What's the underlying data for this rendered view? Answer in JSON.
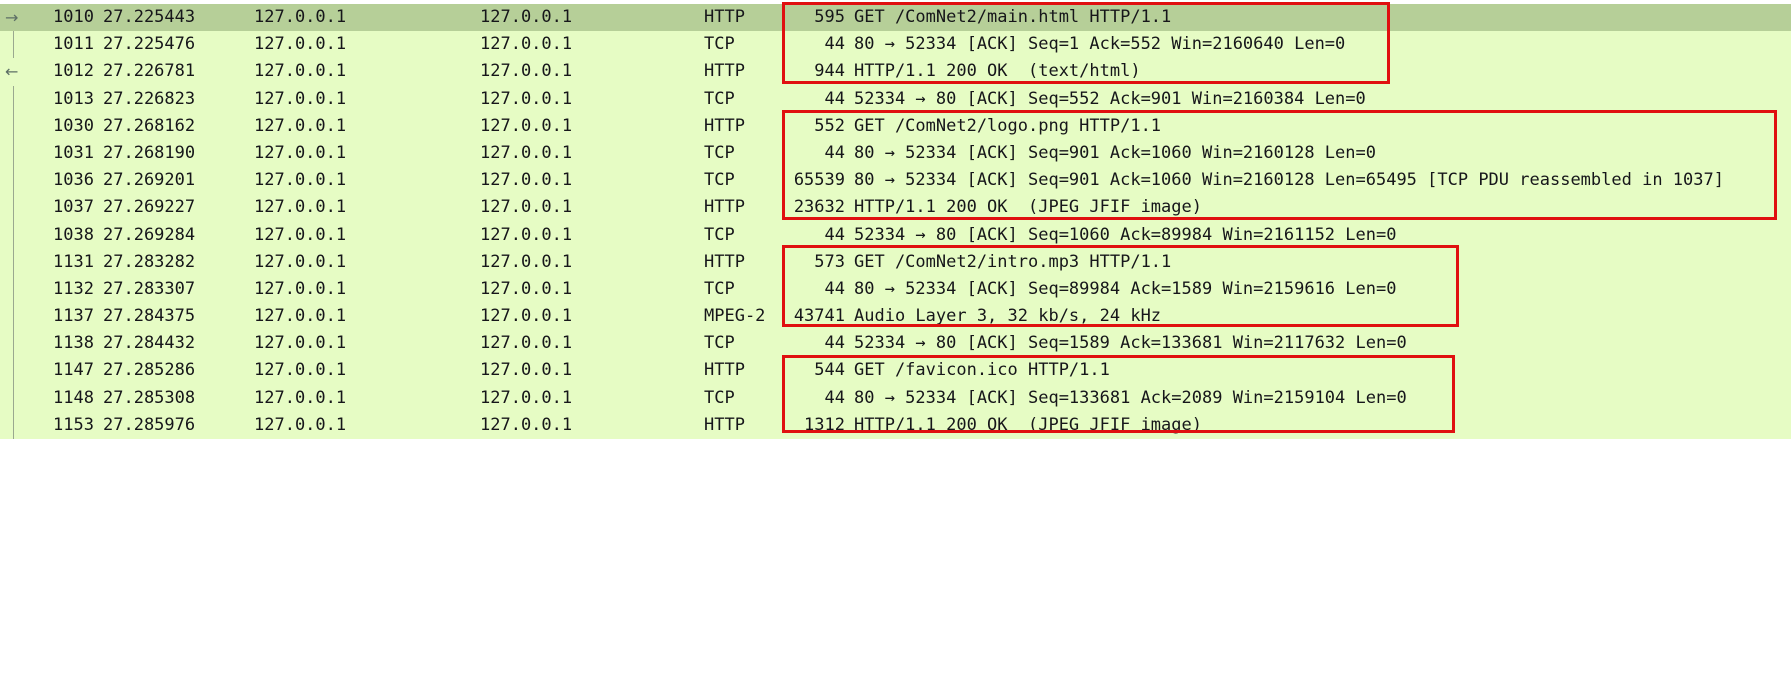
{
  "packets": [
    {
      "no": "1010",
      "time": "27.225443",
      "src": "127.0.0.1",
      "dst": "127.0.0.1",
      "proto": "HTTP",
      "len": "595",
      "info": "GET /ComNet2/main.html HTTP/1.1"
    },
    {
      "no": "1011",
      "time": "27.225476",
      "src": "127.0.0.1",
      "dst": "127.0.0.1",
      "proto": "TCP",
      "len": "44",
      "info": "80 → 52334 [ACK] Seq=1 Ack=552 Win=2160640 Len=0"
    },
    {
      "no": "1012",
      "time": "27.226781",
      "src": "127.0.0.1",
      "dst": "127.0.0.1",
      "proto": "HTTP",
      "len": "944",
      "info": "HTTP/1.1 200 OK  (text/html)"
    },
    {
      "no": "1013",
      "time": "27.226823",
      "src": "127.0.0.1",
      "dst": "127.0.0.1",
      "proto": "TCP",
      "len": "44",
      "info": "52334 → 80 [ACK] Seq=552 Ack=901 Win=2160384 Len=0"
    },
    {
      "no": "1030",
      "time": "27.268162",
      "src": "127.0.0.1",
      "dst": "127.0.0.1",
      "proto": "HTTP",
      "len": "552",
      "info": "GET /ComNet2/logo.png HTTP/1.1"
    },
    {
      "no": "1031",
      "time": "27.268190",
      "src": "127.0.0.1",
      "dst": "127.0.0.1",
      "proto": "TCP",
      "len": "44",
      "info": "80 → 52334 [ACK] Seq=901 Ack=1060 Win=2160128 Len=0"
    },
    {
      "no": "1036",
      "time": "27.269201",
      "src": "127.0.0.1",
      "dst": "127.0.0.1",
      "proto": "TCP",
      "len": "65539",
      "info": "80 → 52334 [ACK] Seq=901 Ack=1060 Win=2160128 Len=65495 [TCP PDU reassembled in 1037]"
    },
    {
      "no": "1037",
      "time": "27.269227",
      "src": "127.0.0.1",
      "dst": "127.0.0.1",
      "proto": "HTTP",
      "len": "23632",
      "info": "HTTP/1.1 200 OK  (JPEG JFIF image)"
    },
    {
      "no": "1038",
      "time": "27.269284",
      "src": "127.0.0.1",
      "dst": "127.0.0.1",
      "proto": "TCP",
      "len": "44",
      "info": "52334 → 80 [ACK] Seq=1060 Ack=89984 Win=2161152 Len=0"
    },
    {
      "no": "1131",
      "time": "27.283282",
      "src": "127.0.0.1",
      "dst": "127.0.0.1",
      "proto": "HTTP",
      "len": "573",
      "info": "GET /ComNet2/intro.mp3 HTTP/1.1"
    },
    {
      "no": "1132",
      "time": "27.283307",
      "src": "127.0.0.1",
      "dst": "127.0.0.1",
      "proto": "TCP",
      "len": "44",
      "info": "80 → 52334 [ACK] Seq=89984 Ack=1589 Win=2159616 Len=0"
    },
    {
      "no": "1137",
      "time": "27.284375",
      "src": "127.0.0.1",
      "dst": "127.0.0.1",
      "proto": "MPEG-2",
      "len": "43741",
      "info": "Audio Layer 3, 32 kb/s, 24 kHz"
    },
    {
      "no": "1138",
      "time": "27.284432",
      "src": "127.0.0.1",
      "dst": "127.0.0.1",
      "proto": "TCP",
      "len": "44",
      "info": "52334 → 80 [ACK] Seq=1589 Ack=133681 Win=2117632 Len=0"
    },
    {
      "no": "1147",
      "time": "27.285286",
      "src": "127.0.0.1",
      "dst": "127.0.0.1",
      "proto": "HTTP",
      "len": "544",
      "info": "GET /favicon.ico HTTP/1.1"
    },
    {
      "no": "1148",
      "time": "27.285308",
      "src": "127.0.0.1",
      "dst": "127.0.0.1",
      "proto": "TCP",
      "len": "44",
      "info": "80 → 52334 [ACK] Seq=133681 Ack=2089 Win=2159104 Len=0"
    },
    {
      "no": "1153",
      "time": "27.285976",
      "src": "127.0.0.1",
      "dst": "127.0.0.1",
      "proto": "HTTP",
      "len": "1312",
      "info": "HTTP/1.1 200 OK  (JPEG JFIF image)"
    }
  ],
  "row_colors": {
    "default": "#e6fcc4",
    "selected": "#b6cf98"
  },
  "highlight_color": "#e01010",
  "gutter_icons": {
    "request": "arrow-right-icon",
    "response": "arrow-left-icon"
  }
}
